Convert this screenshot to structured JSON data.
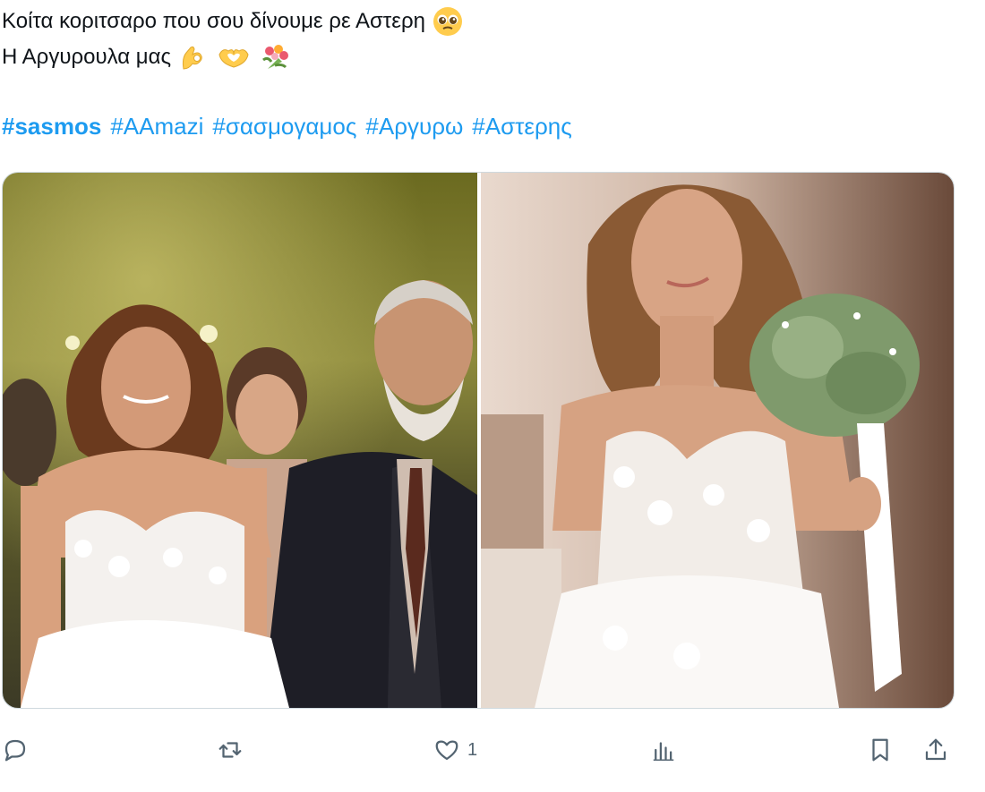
{
  "tweet": {
    "line1": "Κοίτα κοριτσαρο που σου δίνουμε ρε Αστερη",
    "line2": "Η Αργυρουλα μας",
    "hashtags": [
      "#sasmos",
      "#AAmazi",
      "#σασμογαμος",
      "#Αργυρω",
      "#Αστερης"
    ]
  },
  "emojis": {
    "line1": [
      "pleading-face-emoji"
    ],
    "line2": [
      "ok-hand-emoji",
      "heart-hands-emoji",
      "bouquet-emoji"
    ]
  },
  "actions": {
    "reply_count": "",
    "retweet_count": "",
    "like_count": "1",
    "views_count": ""
  },
  "colors": {
    "hashtag": "#1d9bf0",
    "icon": "#536471"
  }
}
